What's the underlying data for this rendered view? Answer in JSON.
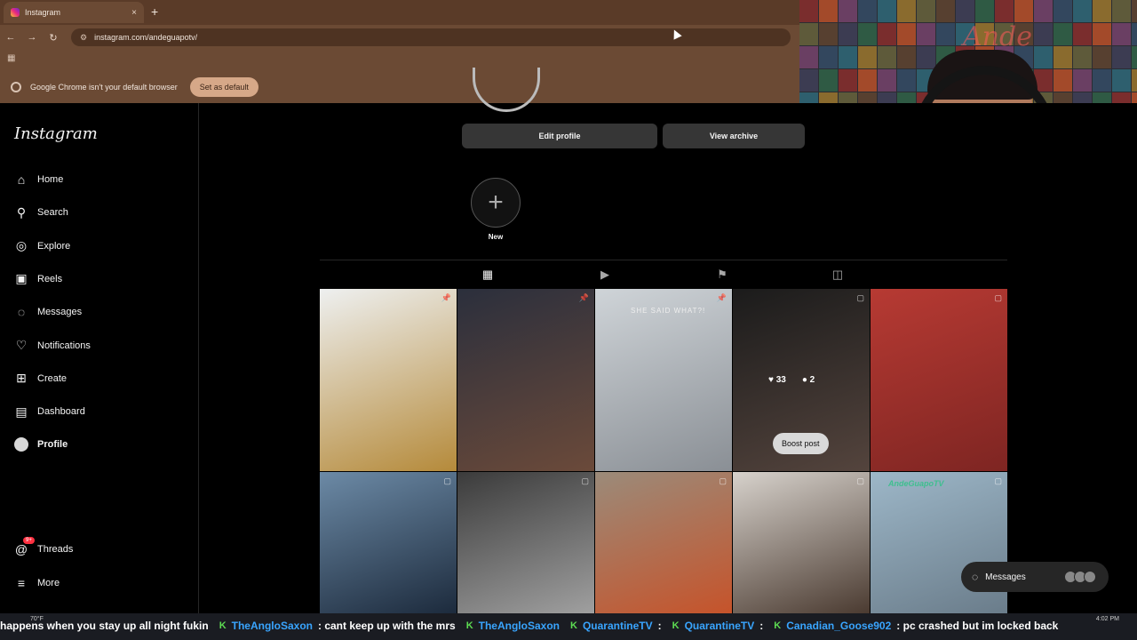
{
  "browser": {
    "tab_title": "Instagram",
    "tab_close": "×",
    "new_tab": "+",
    "url": "instagram.com/andeguapotv/",
    "infobar_text": "Google Chrome isn't your default browser",
    "set_default_label": "Set as default"
  },
  "sidebar": {
    "logo": "Instagram",
    "items": [
      {
        "label": "Home",
        "icon": "home-icon",
        "glyph": "⌂"
      },
      {
        "label": "Search",
        "icon": "search-icon",
        "glyph": "⚲"
      },
      {
        "label": "Explore",
        "icon": "compass-icon",
        "glyph": "◎"
      },
      {
        "label": "Reels",
        "icon": "reels-icon",
        "glyph": "▣"
      },
      {
        "label": "Messages",
        "icon": "messenger-icon",
        "glyph": "◌"
      },
      {
        "label": "Notifications",
        "icon": "heart-icon",
        "glyph": "♡"
      },
      {
        "label": "Create",
        "icon": "plus-square-icon",
        "glyph": "⊞"
      },
      {
        "label": "Dashboard",
        "icon": "chart-icon",
        "glyph": "▤"
      },
      {
        "label": "Profile",
        "icon": "profile-avatar"
      }
    ],
    "threads_label": "Threads",
    "threads_badge": "9+",
    "more_label": "More"
  },
  "profile": {
    "edit_profile_label": "Edit profile",
    "view_archive_label": "View archive",
    "new_highlight_label": "New"
  },
  "tabs": [
    {
      "name": "posts",
      "glyph": "▦"
    },
    {
      "name": "reels",
      "glyph": "▶"
    },
    {
      "name": "saved",
      "glyph": "⚑"
    },
    {
      "name": "tagged",
      "glyph": "◫"
    }
  ],
  "posts": [
    {
      "colors": [
        "#eef0f0",
        "#b58a3a"
      ],
      "pinned": true
    },
    {
      "colors": [
        "#2b2f3c",
        "#6b4a3a"
      ],
      "pinned": true
    },
    {
      "colors": [
        "#cfd4d8",
        "#8a8f95"
      ],
      "pinned": true,
      "caption": "SHE SAID WHAT?!"
    },
    {
      "colors": [
        "#1b1b1b",
        "#54443d"
      ],
      "likes": "33",
      "comments": "2",
      "boost": "Boost post"
    },
    {
      "colors": [
        "#b73a33",
        "#7e2522"
      ]
    },
    {
      "colors": [
        "#6c8aa6",
        "#1c2a3c"
      ]
    },
    {
      "colors": [
        "#3b3b3b",
        "#a0a0a0"
      ]
    },
    {
      "colors": [
        "#9b8b7a",
        "#c6532a"
      ]
    },
    {
      "colors": [
        "#d7d2cc",
        "#4a3a30"
      ]
    },
    {
      "colors": [
        "#9db7c8",
        "#6a7c8a"
      ],
      "tag": "AndeGuapoTV"
    }
  ],
  "messages_pill": {
    "label": "Messages"
  },
  "chat_ticker": [
    {
      "type": "msg",
      "text": "happens when you stay up all night fukin"
    },
    {
      "type": "user",
      "text": "TheAngloSaxon"
    },
    {
      "type": "msg",
      "text": ": cant keep up with the mrs"
    },
    {
      "type": "user",
      "text": "TheAngloSaxon"
    },
    {
      "type": "user",
      "text": "QuarantineTV"
    },
    {
      "type": "msg",
      "text": ":"
    },
    {
      "type": "user",
      "text": "QuarantineTV"
    },
    {
      "type": "msg",
      "text": ":"
    },
    {
      "type": "user",
      "text": "Canadian_Goose902"
    },
    {
      "type": "msg",
      "text": ": pc crashed but im locked back"
    }
  ],
  "taskbar": {
    "weather": "70°F",
    "clock": "4:02 PM"
  },
  "webcam": {
    "neon_text": "Ande"
  }
}
